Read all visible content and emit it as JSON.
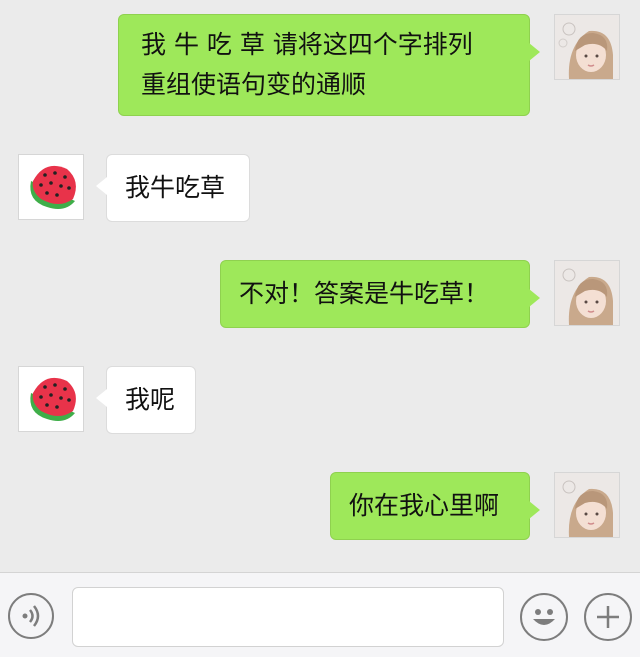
{
  "messages": [
    {
      "side": "sent",
      "lines": [
        "我 牛 吃 草 请将这四个字排列",
        "重组使语句变的通顺"
      ]
    },
    {
      "side": "received",
      "lines": [
        "我牛吃草"
      ]
    },
    {
      "side": "sent",
      "lines": [
        "不对！答案是牛吃草！"
      ]
    },
    {
      "side": "received",
      "lines": [
        "我呢"
      ]
    },
    {
      "side": "sent",
      "lines": [
        "你在我心里啊"
      ]
    }
  ],
  "colors": {
    "sent_bubble": "#9ee85a",
    "received_bubble": "#ffffff",
    "background": "#ebebeb",
    "watermelon_red": "#e8334a",
    "watermelon_green": "#3fae49"
  },
  "avatars": {
    "self": "girl-photo-avatar",
    "other": "watermelon-avatar"
  },
  "input_bar": {
    "voice_icon": "voice-icon",
    "text_value": "",
    "emoji_icon": "emoji-icon",
    "plus_icon": "plus-icon"
  }
}
